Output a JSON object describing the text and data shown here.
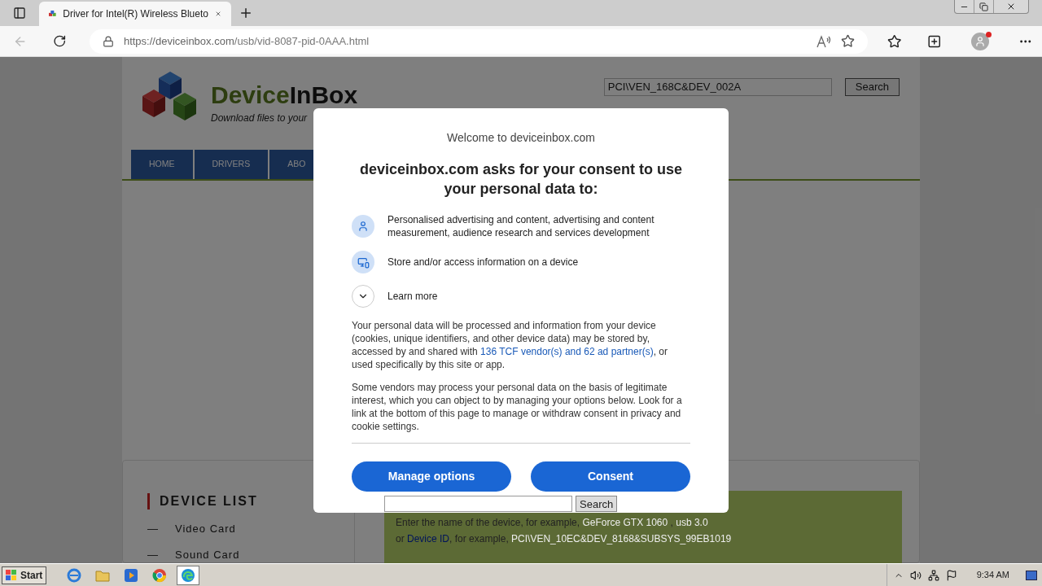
{
  "browser": {
    "tabs": [
      {
        "title": "Driver for Intel(R) Wireless Blueto",
        "selected": true
      }
    ],
    "url": {
      "host": "https://deviceinbox.com",
      "path": "/usb/vid-8087-pid-0AAA.html"
    }
  },
  "page": {
    "logo": {
      "name_a": "Device",
      "name_b": "InBox",
      "tagline": "Download files to your"
    },
    "search": {
      "value": "PCI\\VEN_168C&DEV_002A",
      "button": "Search"
    },
    "nav": [
      {
        "label": "HOME"
      },
      {
        "label": "DRIVERS"
      },
      {
        "label": "ABO"
      }
    ],
    "device_list": {
      "title": "DEVICE LIST",
      "items": [
        {
          "marker": "—",
          "label": "Video Card"
        },
        {
          "marker": "—",
          "label": "Sound Card"
        }
      ]
    },
    "device_search": {
      "button": "Search",
      "line1": {
        "text": "Enter the name of the device, for example, ",
        "example_1": "GeForce GTX 1060",
        "separator": " , ",
        "example_2": "usb 3.0"
      },
      "line2": {
        "text_a": "or ",
        "link": "Device ID",
        "text_b": ", for example, ",
        "example": "PCI\\VEN_10EC&DEV_8168&SUBSYS_99EB1019"
      }
    }
  },
  "dialog": {
    "welcome": "Welcome to deviceinbox.com",
    "heading": "deviceinbox.com asks for your consent to use your personal data to:",
    "purposes": [
      {
        "kind": "person",
        "text": "Personalised advertising and content, advertising and content measurement, audience research and services development"
      },
      {
        "kind": "device",
        "text": "Store and/or access information on a device"
      }
    ],
    "learn_more": {
      "label": "Learn more",
      "expanded": false
    },
    "paragraph_1": {
      "before": "Your personal data will be processed and information from your device (cookies, unique identifiers, and other device data) may be stored by, accessed by and shared with ",
      "link": "136 TCF vendor(s) and 62 ad partner(s)",
      "after": ", or used specifically by this site or app."
    },
    "paragraph_2": "Some vendors may process your personal data on the basis of legitimate interest, which you can object to by managing your options below. Look for a link at the bottom of this page to manage or withdraw consent in privacy and cookie settings.",
    "buttons": [
      "Manage options",
      "Consent"
    ]
  },
  "taskbar": {
    "start": "Start",
    "apps": [
      {
        "kind": "ie",
        "selected": false
      },
      {
        "kind": "folder",
        "selected": false
      },
      {
        "kind": "media",
        "selected": false
      },
      {
        "kind": "chrome",
        "selected": false
      },
      {
        "kind": "edge",
        "selected": true
      }
    ],
    "clock": "9:34 AM"
  }
}
